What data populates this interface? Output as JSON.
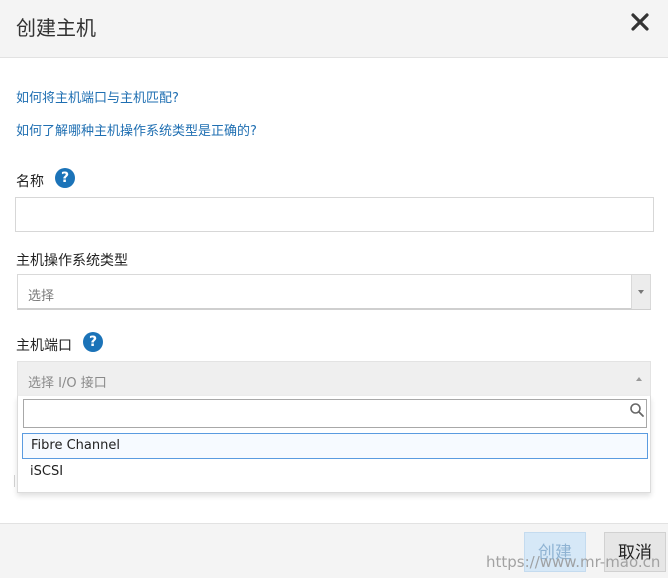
{
  "dialog": {
    "title": "创建主机",
    "close_icon": "close-icon"
  },
  "help_links": {
    "ports_link": "如何将主机端口与主机匹配?",
    "os_link": "如何了解哪种主机操作系统类型是正确的?"
  },
  "name": {
    "label": "名称",
    "value": "",
    "help_icon": "?"
  },
  "os_type": {
    "label": "主机操作系统类型",
    "selected": "选择",
    "arrow_icon": "chevron-down-icon"
  },
  "host_ports": {
    "label": "主机端口",
    "help_icon": "?",
    "placeholder": "选择 I/O 接口",
    "search_value": "",
    "options": [
      "Fibre Channel",
      "iSCSI"
    ]
  },
  "footer": {
    "create_label": "创建",
    "cancel_label": "取消"
  },
  "watermark": "https://www.mr-mao.cn"
}
